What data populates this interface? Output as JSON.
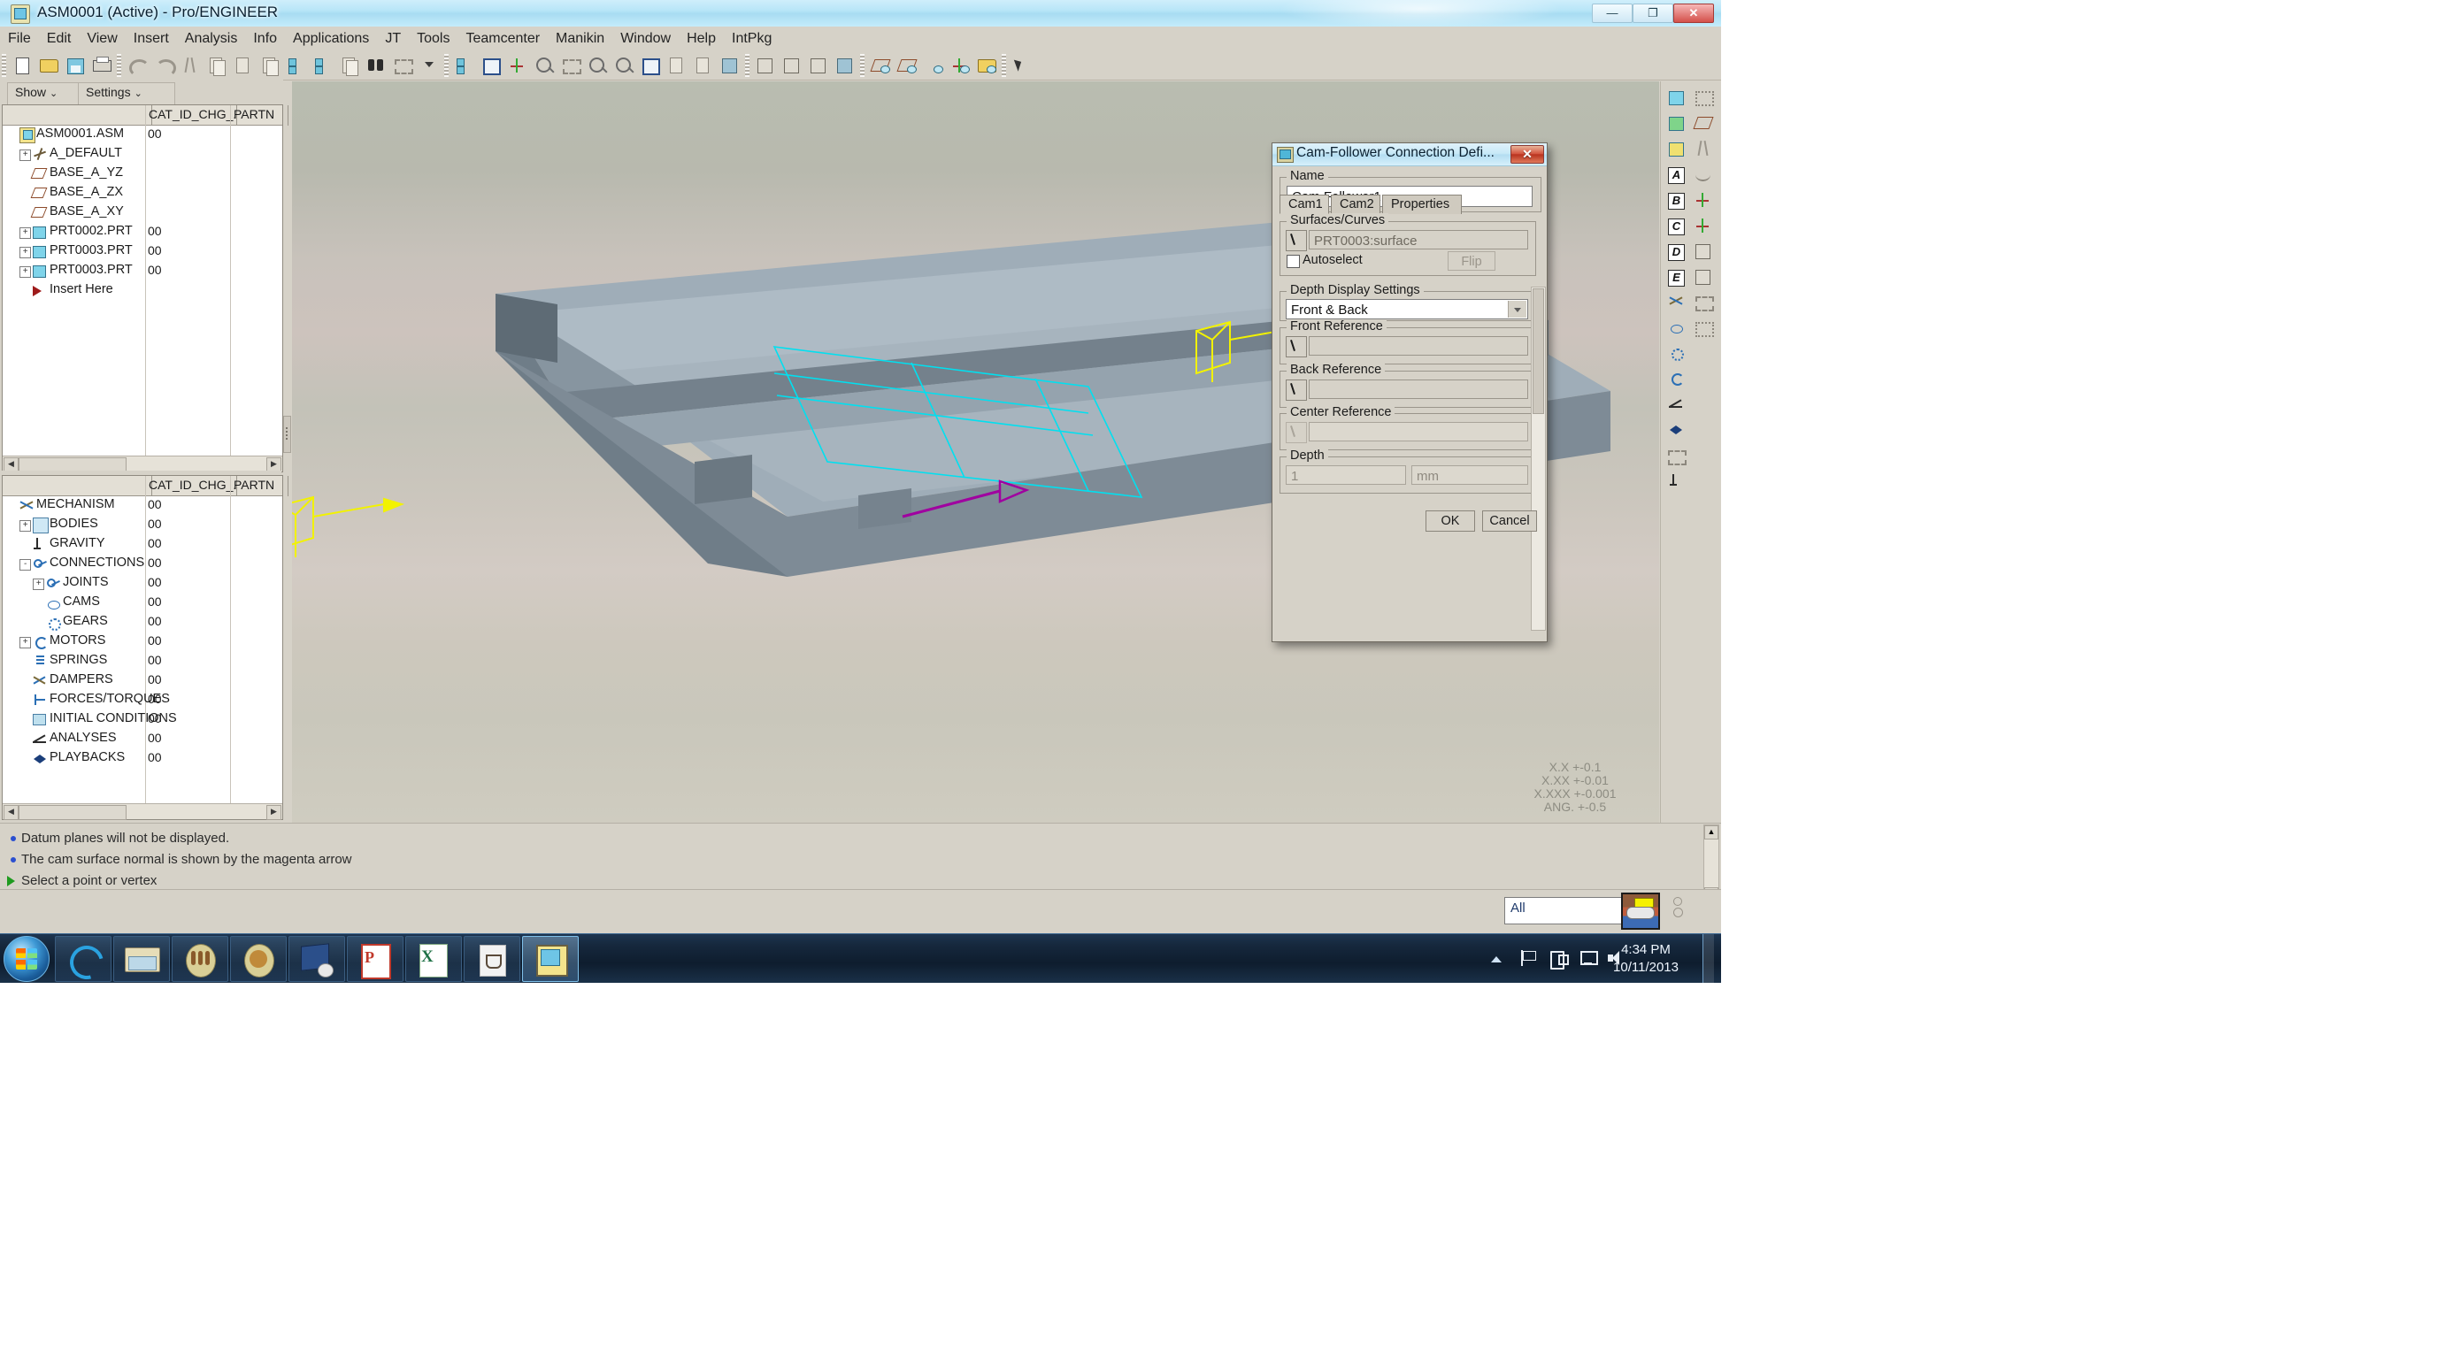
{
  "window": {
    "title": "ASM0001 (Active) - Pro/ENGINEER",
    "minimize_label": "—",
    "maximize_label": "❐",
    "close_label": "✕"
  },
  "menubar": {
    "items": [
      {
        "label": "File"
      },
      {
        "label": "Edit"
      },
      {
        "label": "View"
      },
      {
        "label": "Insert"
      },
      {
        "label": "Analysis"
      },
      {
        "label": "Info"
      },
      {
        "label": "Applications"
      },
      {
        "label": "JT"
      },
      {
        "label": "Tools"
      },
      {
        "label": "Teamcenter"
      },
      {
        "label": "Manikin"
      },
      {
        "label": "Window"
      },
      {
        "label": "Help"
      },
      {
        "label": "IntPkg"
      }
    ]
  },
  "tree_tools": {
    "show_label": "Show",
    "settings_label": "Settings",
    "caret": "⌄"
  },
  "model_tree": {
    "columns": [
      "",
      "CAT_ID_CHG_...",
      "PARTN"
    ],
    "rows": [
      {
        "label": "ASM0001.ASM",
        "value": "00",
        "indent": 0,
        "icon": "assembly-icon",
        "expander": ""
      },
      {
        "label": "A_DEFAULT",
        "value": "",
        "indent": 1,
        "icon": "coordinate-system-icon",
        "expander": "+"
      },
      {
        "label": "BASE_A_YZ",
        "value": "",
        "indent": 1,
        "icon": "datum-plane-icon",
        "expander": ""
      },
      {
        "label": "BASE_A_ZX",
        "value": "",
        "indent": 1,
        "icon": "datum-plane-icon",
        "expander": ""
      },
      {
        "label": "BASE_A_XY",
        "value": "",
        "indent": 1,
        "icon": "datum-plane-icon",
        "expander": ""
      },
      {
        "label": "PRT0002.PRT",
        "value": "00",
        "indent": 1,
        "icon": "part-icon",
        "expander": "+"
      },
      {
        "label": "PRT0003.PRT",
        "value": "00",
        "indent": 1,
        "icon": "part-icon",
        "expander": "+"
      },
      {
        "label": "PRT0003.PRT",
        "value": "00",
        "indent": 1,
        "icon": "part-icon",
        "expander": "+"
      },
      {
        "label": "Insert Here",
        "value": "",
        "indent": 1,
        "icon": "insert-here-icon",
        "expander": ""
      }
    ]
  },
  "mechanism_tree": {
    "columns": [
      "",
      "CAT_ID_CHG_...",
      "PARTN"
    ],
    "rows": [
      {
        "label": "MECHANISM",
        "value": "00",
        "indent": 0,
        "icon": "mechanism-icon",
        "expander": ""
      },
      {
        "label": "BODIES",
        "value": "00",
        "indent": 1,
        "icon": "bodies-icon",
        "expander": "+"
      },
      {
        "label": "GRAVITY",
        "value": "00",
        "indent": 1,
        "icon": "gravity-icon",
        "expander": ""
      },
      {
        "label": "CONNECTIONS",
        "value": "00",
        "indent": 1,
        "icon": "connections-icon",
        "expander": "-"
      },
      {
        "label": "JOINTS",
        "value": "00",
        "indent": 2,
        "icon": "joints-icon",
        "expander": "+"
      },
      {
        "label": "CAMS",
        "value": "00",
        "indent": 2,
        "icon": "cams-icon",
        "expander": ""
      },
      {
        "label": "GEARS",
        "value": "00",
        "indent": 2,
        "icon": "gears-icon",
        "expander": ""
      },
      {
        "label": "MOTORS",
        "value": "00",
        "indent": 1,
        "icon": "motors-icon",
        "expander": "+"
      },
      {
        "label": "SPRINGS",
        "value": "00",
        "indent": 1,
        "icon": "springs-icon",
        "expander": ""
      },
      {
        "label": "DAMPERS",
        "value": "00",
        "indent": 1,
        "icon": "dampers-icon",
        "expander": ""
      },
      {
        "label": "FORCES/TORQUES",
        "value": "00",
        "indent": 1,
        "icon": "forces-icon",
        "expander": ""
      },
      {
        "label": "INITIAL CONDITIONS",
        "value": "00",
        "indent": 1,
        "icon": "initial-conditions-icon",
        "expander": ""
      },
      {
        "label": "ANALYSES",
        "value": "00",
        "indent": 1,
        "icon": "analyses-icon",
        "expander": ""
      },
      {
        "label": "PLAYBACKS",
        "value": "00",
        "indent": 1,
        "icon": "playbacks-icon",
        "expander": ""
      }
    ]
  },
  "graphics": {
    "tolerance_block": [
      "X.X +-0.1",
      "X.XX +-0.01",
      "X.XXX +-0.001",
      "ANG. +-0.5"
    ]
  },
  "messages": [
    {
      "text": "Datum planes will not be displayed.",
      "marker": "bullet"
    },
    {
      "text": "The cam surface normal is shown by the magenta arrow",
      "marker": "bullet"
    },
    {
      "text": "Select a point or vertex",
      "marker": "arrow"
    }
  ],
  "filter_bar": {
    "value": "All"
  },
  "dialog": {
    "title": "Cam-Follower Connection Defi...",
    "close_label": "✕",
    "name_group_label": "Name",
    "name_value": "Cam Follower1",
    "tabs": [
      {
        "label": "Cam1",
        "active": true
      },
      {
        "label": "Cam2",
        "active": false
      },
      {
        "label": "Properties",
        "active": false
      }
    ],
    "surfaces_group_label": "Surfaces/Curves",
    "surface_value": "PRT0003:surface",
    "autoselect_label": "Autoselect",
    "autoselect_checked": false,
    "flip_label": "Flip",
    "flip_enabled": false,
    "depth_display_group_label": "Depth Display Settings",
    "depth_display_value": "Front & Back",
    "front_reference_label": "Front Reference",
    "front_reference_value": "",
    "back_reference_label": "Back Reference",
    "back_reference_value": "",
    "center_reference_label": "Center Reference",
    "center_reference_value": "",
    "center_reference_enabled": false,
    "depth_group_label": "Depth",
    "depth_value": "1",
    "depth_unit": "mm",
    "depth_enabled": false,
    "ok_label": "OK",
    "cancel_label": "Cancel"
  },
  "taskbar": {
    "clock_time": "4:34 PM",
    "clock_date": "10/11/2013",
    "items": [
      {
        "name": "internet-explorer"
      },
      {
        "name": "windows-explorer"
      },
      {
        "name": "app-gold-1"
      },
      {
        "name": "app-gold-2"
      },
      {
        "name": "remote-desktop"
      },
      {
        "name": "powerpoint"
      },
      {
        "name": "excel"
      },
      {
        "name": "java"
      },
      {
        "name": "proengineer"
      }
    ]
  },
  "colors": {
    "app_face": "#d6d2c8",
    "title_aero": "#b9e6f8",
    "selection_cyan": "#00e5ff",
    "csys_yellow": "#ffff00",
    "normal_magenta": "#b000b0",
    "part_gray": "#9aa7b0"
  }
}
